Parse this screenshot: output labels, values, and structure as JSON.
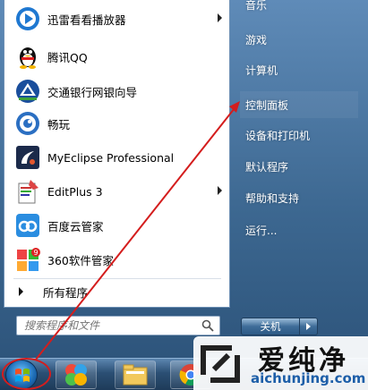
{
  "programs": [
    {
      "label": "迅雷看看播放器",
      "icon": "xunlei-kankan-icon",
      "submenu": true
    },
    {
      "label": "腾讯QQ",
      "icon": "qq-penguin-icon",
      "submenu": false
    },
    {
      "label": "交通银行网银向导",
      "icon": "bocom-bank-icon",
      "submenu": false
    },
    {
      "label": "畅玩",
      "icon": "changwan-icon",
      "submenu": false
    },
    {
      "label": "MyEclipse Professional",
      "icon": "myeclipse-icon",
      "submenu": false
    },
    {
      "label": "EditPlus 3",
      "icon": "editplus-icon",
      "submenu": true
    },
    {
      "label": "百度云管家",
      "icon": "baidu-cloud-icon",
      "submenu": false
    },
    {
      "label": "360软件管家",
      "icon": "360-software-icon",
      "submenu": false
    }
  ],
  "all_programs_label": "所有程序",
  "search": {
    "placeholder": "搜索程序和文件"
  },
  "right_pane": [
    {
      "label": "音乐"
    },
    {
      "label": "游戏"
    },
    {
      "label": "计算机"
    },
    {
      "label": "控制面板"
    },
    {
      "label": "设备和打印机"
    },
    {
      "label": "默认程序"
    },
    {
      "label": "帮助和支持"
    },
    {
      "label": "运行..."
    }
  ],
  "shutdown": {
    "label": "关机"
  },
  "taskbar": {
    "items": [
      "start-orb",
      "360-browser-icon",
      "file-explorer-icon",
      "chrome-icon"
    ]
  },
  "watermark": {
    "title": "爱纯净",
    "url": "aichunjing.com"
  },
  "colors": {
    "annotation": "#d41d1d",
    "url": "#1d5ea8"
  }
}
